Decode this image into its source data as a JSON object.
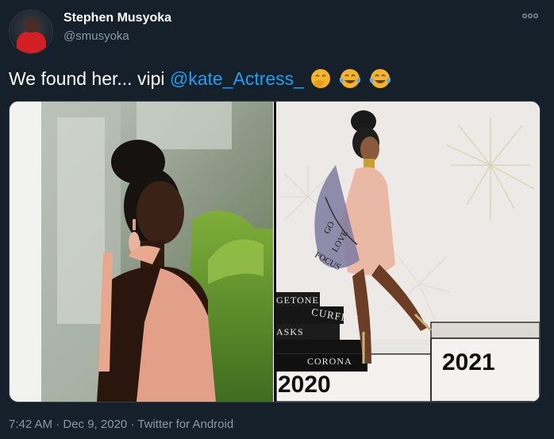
{
  "user": {
    "display_name": "Stephen Musyoka",
    "handle": "@smusyoka"
  },
  "tweet": {
    "text_before": "We found her... vipi ",
    "mention": "@kate_Actress_",
    "emojis": [
      "face-with-hand-over-mouth-emoji",
      "face-with-tears-of-joy-emoji",
      "face-with-tears-of-joy-emoji"
    ]
  },
  "media": {
    "right_panel_stairs": [
      "GETONE",
      "CURFEW",
      "ASKS",
      "CORONA"
    ],
    "year_left": "2020",
    "year_right": "2021",
    "bag_words": [
      "GO",
      "LOVE",
      "FOCUS"
    ]
  },
  "meta": {
    "timestamp": "7:42 AM · Dec 9, 2020 · Twitter for Android"
  },
  "colors": {
    "background": "#15202b",
    "mention": "#1da1f2",
    "secondary_text": "#8899a6"
  }
}
